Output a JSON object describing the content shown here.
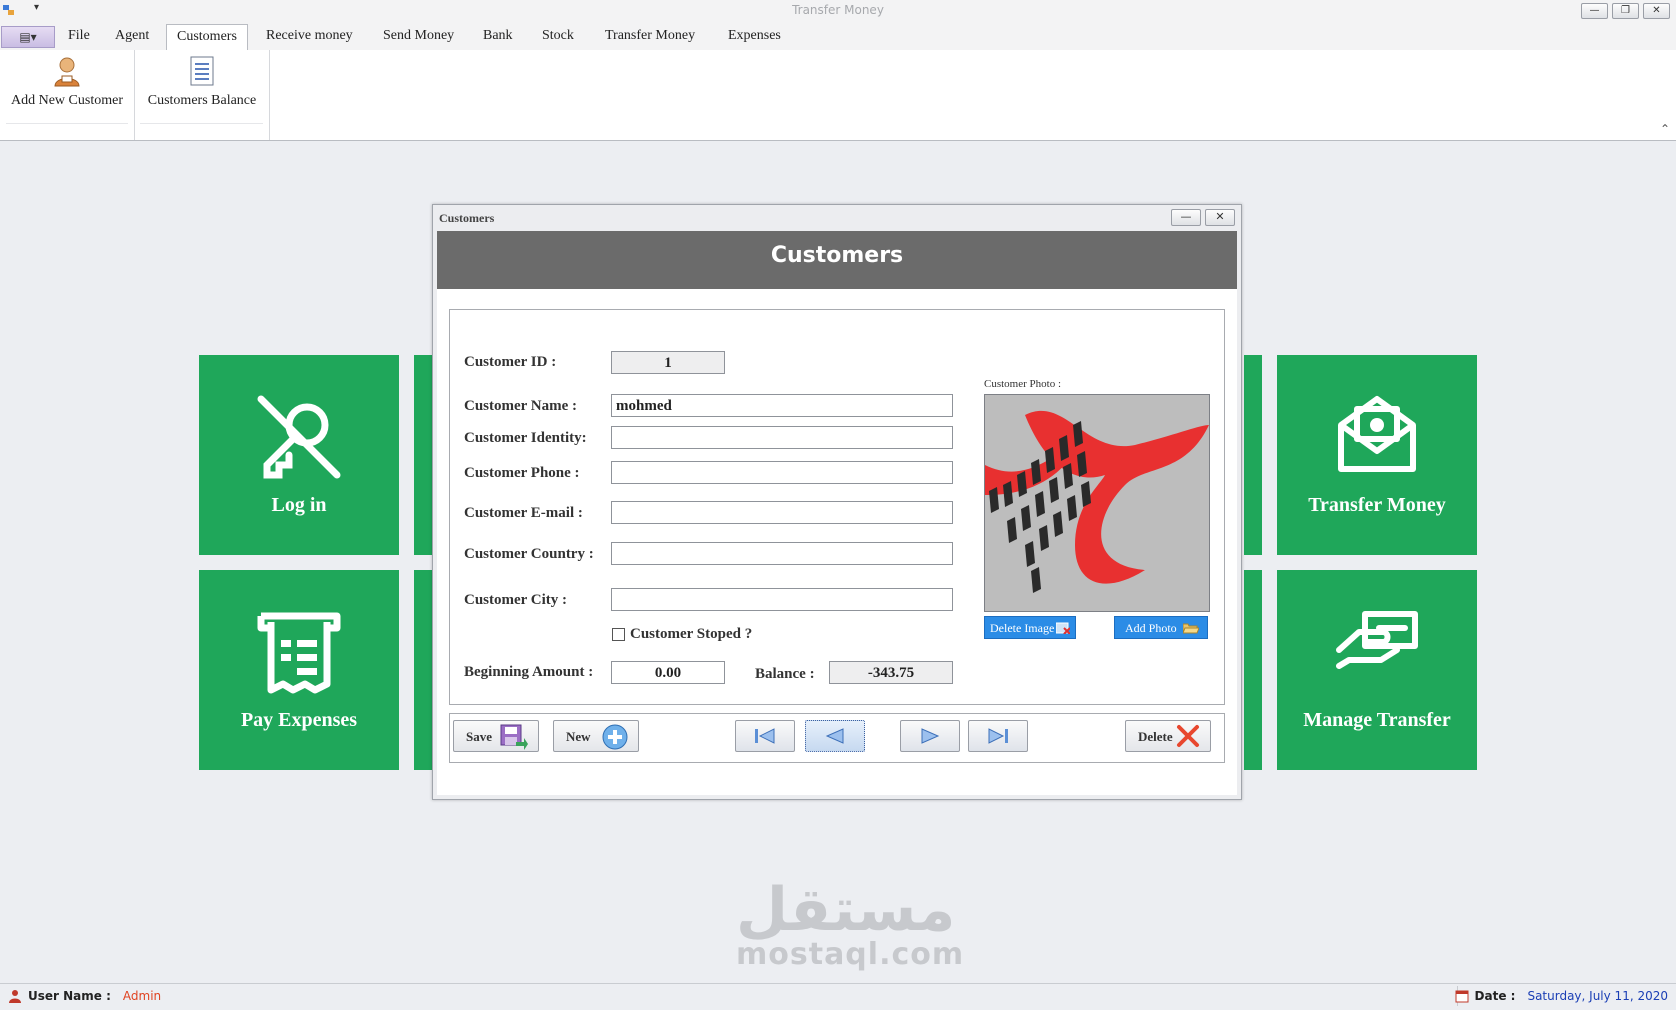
{
  "window": {
    "title": "Transfer Money",
    "minimize": "—",
    "restore": "❐",
    "close": "✕",
    "qa_arrow": "▾",
    "appmenu": "▤▾"
  },
  "tabs": [
    "File",
    "Agent",
    "Customers",
    "Receive money",
    "Send Money",
    "Bank",
    "Stock",
    "Transfer Money",
    "Expenses"
  ],
  "active_tab": "Customers",
  "ribbon": {
    "add_new_customer": "Add New Customer",
    "customers_balance": "Customers Balance",
    "collapse": "⌃"
  },
  "tiles": {
    "login": "Log in",
    "pay_expenses": "Pay Expenses",
    "transfer_money": "Transfer Money",
    "manage_transfer": "Manage Transfer"
  },
  "dialog": {
    "window_title": "Customers",
    "header": "Customers",
    "minimize": "—",
    "close": "✕",
    "labels": {
      "customer_id": "Customer ID :",
      "customer_name": "Customer Name :",
      "customer_identity": "Customer Identity:",
      "customer_phone": "Customer Phone :",
      "customer_email": "Customer E-mail :",
      "customer_country": "Customer Country :",
      "customer_city": "Customer City :",
      "customer_stoped": "Customer Stoped ?",
      "beginning_amount": "Beginning Amount :",
      "balance": "Balance :",
      "customer_photo": "Customer Photo :"
    },
    "values": {
      "customer_id": "1",
      "customer_name": "mohmed",
      "customer_identity": "",
      "customer_phone": "",
      "customer_email": "",
      "customer_country": "",
      "customer_city": "",
      "customer_stoped": false,
      "beginning_amount": "0.00",
      "balance": "-343.75"
    },
    "photo_buttons": {
      "delete_image": "Delete Image",
      "add_photo": "Add Photo"
    },
    "toolbar": {
      "save": "Save",
      "new": "New",
      "delete": "Delete"
    }
  },
  "watermark": {
    "arabic": "مستقل",
    "latin": "mostaql.com"
  },
  "status": {
    "user_label": "User Name :",
    "user_value": "Admin",
    "date_label": "Date :",
    "date_value": "Saturday, July 11, 2020"
  },
  "colors": {
    "tile_green": "#1fa75a",
    "header_gray": "#6b6b6b",
    "photo_button_blue": "#2b8ce6",
    "user_red": "#e04321",
    "date_blue": "#1b3fb5"
  }
}
